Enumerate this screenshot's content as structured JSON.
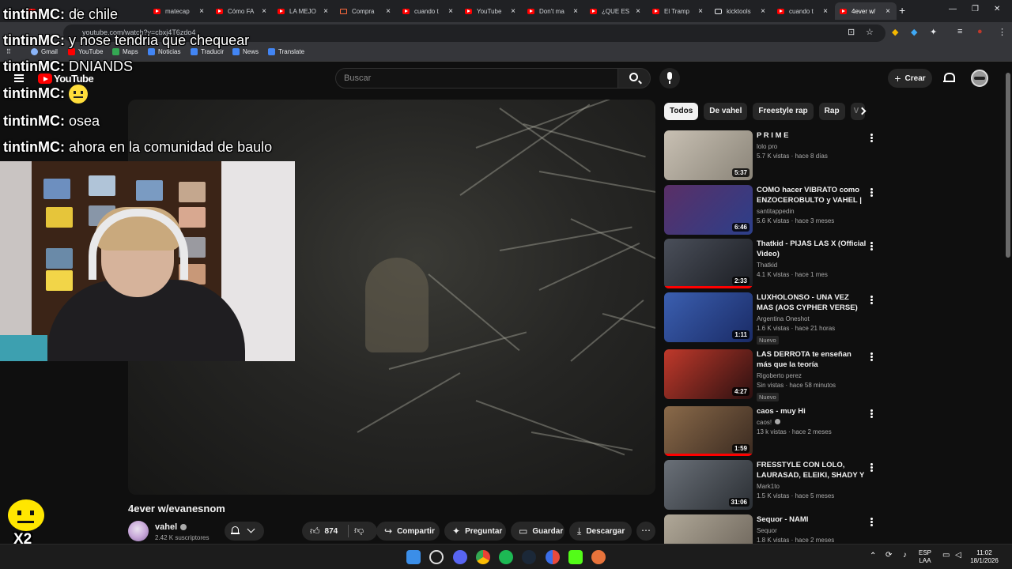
{
  "browser": {
    "tabs": [
      {
        "title": "",
        "favicon": "youtube"
      },
      {
        "title": "matecap",
        "favicon": "youtube"
      },
      {
        "title": "Cómo FA",
        "favicon": "youtube"
      },
      {
        "title": "LA MEJO",
        "favicon": "youtube"
      },
      {
        "title": "Compra",
        "favicon": "pdf"
      },
      {
        "title": "cuando t",
        "favicon": "youtube"
      },
      {
        "title": "YouTube",
        "favicon": "youtube"
      },
      {
        "title": "Don't ma",
        "favicon": "youtube"
      },
      {
        "title": "¿QUE ES",
        "favicon": "youtube"
      },
      {
        "title": "El Tramp",
        "favicon": "youtube"
      },
      {
        "title": "kicktools",
        "favicon": "grid"
      },
      {
        "title": "cuando t",
        "favicon": "youtube"
      },
      {
        "title": "4ever w/",
        "favicon": "youtube",
        "active": true
      }
    ],
    "url": "youtube.com/watch?v=cbxj4T6zdo4",
    "bookmarks": [
      "Gmail",
      "YouTube",
      "Maps",
      "Noticias",
      "Traducir",
      "News",
      "Translate"
    ]
  },
  "youtube": {
    "logo_text": "YouTube",
    "search_placeholder": "Buscar",
    "create_label": "Crear"
  },
  "chat": [
    {
      "user": "tintinMC:",
      "text": "de chile"
    },
    {
      "user": "tintinMC:",
      "text": "y nose tendria que chequear"
    },
    {
      "user": "tintinMC:",
      "text": "DNIANDS"
    },
    {
      "user": "tintinMC:",
      "text": "",
      "emoji": "neutral-face"
    },
    {
      "user": "tintinMC:",
      "text": "osea"
    },
    {
      "user": "tintinMC:",
      "text": "ahora en la comunidad de baulo"
    }
  ],
  "sticker_label": "X2",
  "video": {
    "title": "4ever w/evanesnom",
    "channel": "vahel",
    "subscribers": "2.42 K suscriptores",
    "likes": "874",
    "actions": {
      "share": "Compartir",
      "ask": "Preguntar",
      "save": "Guardar",
      "download": "Descargar"
    }
  },
  "sidebar": {
    "chips": [
      "Todos",
      "De vahel",
      "Freestyle rap",
      "Rap",
      "V"
    ],
    "recommendations": [
      {
        "title": "P R I M E",
        "channel": "lolo pro",
        "stats": "5.7 K vistas · hace 8 días",
        "duration": "5:37",
        "new": false,
        "verified": false,
        "progress": 0,
        "thumb_colors": [
          "#c8c0b3",
          "#8a8478"
        ]
      },
      {
        "title": "COMO hacer VIBRATO como ENZOCEROBULTO y VAHEL | ...",
        "channel": "santitappedin",
        "stats": "5.6 K vistas · hace 3 meses",
        "duration": "6:46",
        "new": false,
        "verified": false,
        "progress": 0,
        "thumb_colors": [
          "#5a2f66",
          "#2c3f8a"
        ]
      },
      {
        "title": "Thatkid - PIJAS LAS X (Official Video)",
        "channel": "Thatkid",
        "stats": "4.1 K vistas · hace 1 mes",
        "duration": "2:33",
        "new": false,
        "verified": false,
        "progress": 1,
        "thumb_colors": [
          "#4a4f5a",
          "#1b1d22"
        ]
      },
      {
        "title": "LUXHOLONSO - UNA VEZ MAS (AOS CYPHER VERSE)",
        "channel": "Argentina Oneshot",
        "stats": "1.6 K vistas · hace 21 horas",
        "duration": "1:11",
        "new": true,
        "verified": false,
        "progress": 0,
        "thumb_colors": [
          "#3b5fb0",
          "#1a2b66"
        ]
      },
      {
        "title": "LAS DERROTA te enseñan más que la teoría",
        "channel": "Rigoberto perez",
        "stats": "Sin vistas · hace 58 minutos",
        "duration": "4:27",
        "new": true,
        "verified": false,
        "progress": 0,
        "thumb_colors": [
          "#c0392b",
          "#2b1010"
        ]
      },
      {
        "title": "caos - muy Hi",
        "channel": "caos!",
        "stats": "13 k vistas · hace 2 meses",
        "duration": "1:59",
        "new": false,
        "verified": true,
        "progress": 1,
        "thumb_colors": [
          "#8a6a4a",
          "#3a2a20"
        ]
      },
      {
        "title": "FRESSTYLE CON LOLO, LAURASAD, ELEIKI, SHADY Y ...",
        "channel": "Mark1to",
        "stats": "1.5 K vistas · hace 5 meses",
        "duration": "31:06",
        "new": false,
        "verified": false,
        "progress": 0,
        "thumb_colors": [
          "#6a7078",
          "#2a2e33"
        ]
      },
      {
        "title": "Sequor - NAMI",
        "channel": "Sequor",
        "stats": "1.8 K vistas · hace 2 meses",
        "duration": "",
        "new": false,
        "verified": false,
        "progress": 0,
        "thumb_colors": [
          "#b0a898",
          "#6a6258"
        ]
      }
    ],
    "new_label": "Nuevo"
  },
  "taskbar": {
    "lang_line1": "ESP",
    "lang_line2": "LAA",
    "time": "11:02",
    "date": "18/1/2026"
  }
}
